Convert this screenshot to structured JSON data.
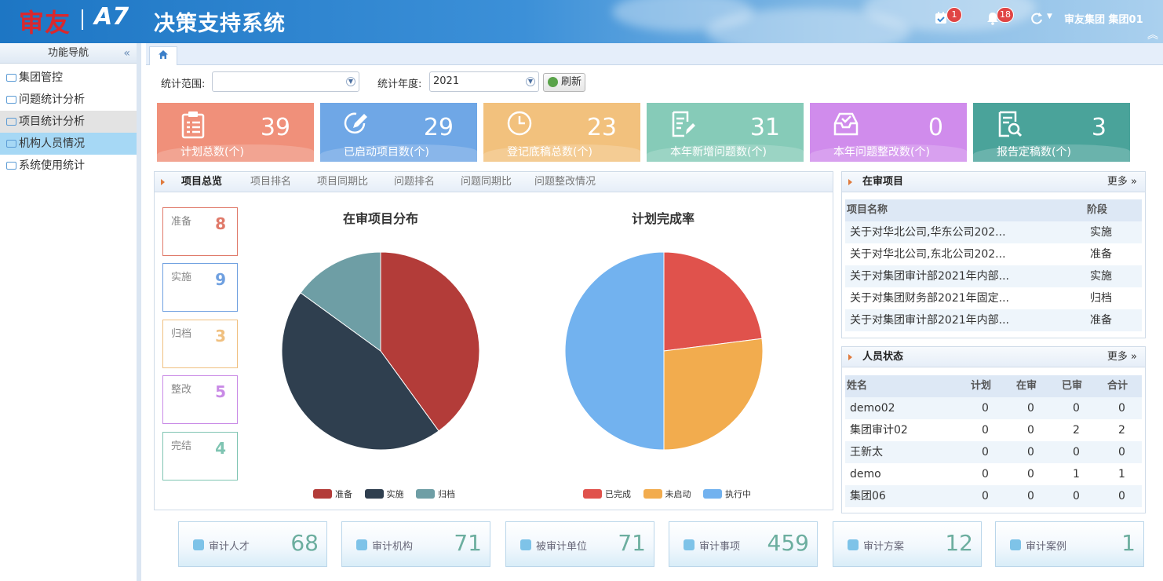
{
  "header": {
    "brand": "审友",
    "product": "A7",
    "title": "决策支持系统",
    "calendar_badge": "1",
    "bell_badge": "18",
    "user": "审友集团  集团01"
  },
  "sidebar": {
    "title": "功能导航",
    "items": [
      {
        "label": "集团管控"
      },
      {
        "label": "问题统计分析"
      },
      {
        "label": "项目统计分析"
      },
      {
        "label": "机构人员情况"
      },
      {
        "label": "系统使用统计"
      }
    ]
  },
  "filters": {
    "scope_label": "统计范围:",
    "scope_value": "",
    "year_label": "统计年度:",
    "year_value": "2021",
    "refresh": "刷新"
  },
  "stats": [
    {
      "value": "39",
      "label": "计划总数(个)",
      "color": "#f0907a"
    },
    {
      "value": "29",
      "label": "已启动项目数(个)",
      "color": "#6fa7e6"
    },
    {
      "value": "23",
      "label": "登记底稿总数(个)",
      "color": "#f2c17d"
    },
    {
      "value": "31",
      "label": "本年新增问题数(个)",
      "color": "#86cbb8"
    },
    {
      "value": "0",
      "label": "本年问题整改数(个)",
      "color": "#d08cec"
    },
    {
      "value": "3",
      "label": "报告定稿数(个)",
      "color": "#4aa39a"
    }
  ],
  "main_tabs": [
    "项目总览",
    "项目排名",
    "项目同期比",
    "问题排名",
    "问题同期比",
    "问题整改情况"
  ],
  "phases": [
    {
      "label": "准备",
      "value": "8",
      "color": "#e07a6a"
    },
    {
      "label": "实施",
      "value": "9",
      "color": "#6fa0e0"
    },
    {
      "label": "归档",
      "value": "3",
      "color": "#f0c080"
    },
    {
      "label": "整改",
      "value": "5",
      "color": "#c98ae6"
    },
    {
      "label": "完结",
      "value": "4",
      "color": "#7fc4b2"
    }
  ],
  "chart_data": [
    {
      "type": "pie",
      "title": "在审项目分布",
      "categories": [
        "准备",
        "实施",
        "归档"
      ],
      "values": [
        8,
        9,
        3
      ],
      "colors": [
        "#b33c39",
        "#2f3f4f",
        "#6e9ea5"
      ]
    },
    {
      "type": "pie",
      "title": "计划完成率",
      "categories": [
        "已完成",
        "未启动",
        "执行中"
      ],
      "values": [
        23,
        27,
        50
      ],
      "colors": [
        "#e0524c",
        "#f2ac4e",
        "#72b2ef"
      ]
    }
  ],
  "review_panel": {
    "title": "在审项目",
    "more": "更多 »",
    "col_name": "项目名称",
    "col_stage": "阶段",
    "rows": [
      {
        "name": "关于对华北公司,华东公司202...",
        "stage": "实施"
      },
      {
        "name": "关于对华北公司,东北公司202...",
        "stage": "准备"
      },
      {
        "name": "关于对集团审计部2021年内部...",
        "stage": "实施"
      },
      {
        "name": "关于对集团财务部2021年固定...",
        "stage": "归档"
      },
      {
        "name": "关于对集团审计部2021年内部...",
        "stage": "准备"
      }
    ]
  },
  "staff_panel": {
    "title": "人员状态",
    "more": "更多 »",
    "cols": [
      "姓名",
      "计划",
      "在审",
      "已审",
      "合计"
    ],
    "rows": [
      {
        "name": "demo02",
        "plan": "0",
        "review": "0",
        "done": "0",
        "total": "0"
      },
      {
        "name": "集团审计02",
        "plan": "0",
        "review": "0",
        "done": "2",
        "total": "2"
      },
      {
        "name": "王新太",
        "plan": "0",
        "review": "0",
        "done": "0",
        "total": "0"
      },
      {
        "name": "demo",
        "plan": "0",
        "review": "0",
        "done": "1",
        "total": "1"
      },
      {
        "name": "集团06",
        "plan": "0",
        "review": "0",
        "done": "0",
        "total": "0"
      }
    ]
  },
  "bottom_stats": [
    {
      "label": "审计人才",
      "value": "68",
      "icon": "person-icon"
    },
    {
      "label": "审计机构",
      "value": "71",
      "icon": "document-icon"
    },
    {
      "label": "被审计单位",
      "value": "71",
      "icon": "bar-chart-icon"
    },
    {
      "label": "审计事项",
      "value": "459",
      "icon": "list-icon"
    },
    {
      "label": "审计方案",
      "value": "12",
      "icon": "clipboard-icon"
    },
    {
      "label": "审计案例",
      "value": "1",
      "icon": "layers-icon"
    }
  ]
}
